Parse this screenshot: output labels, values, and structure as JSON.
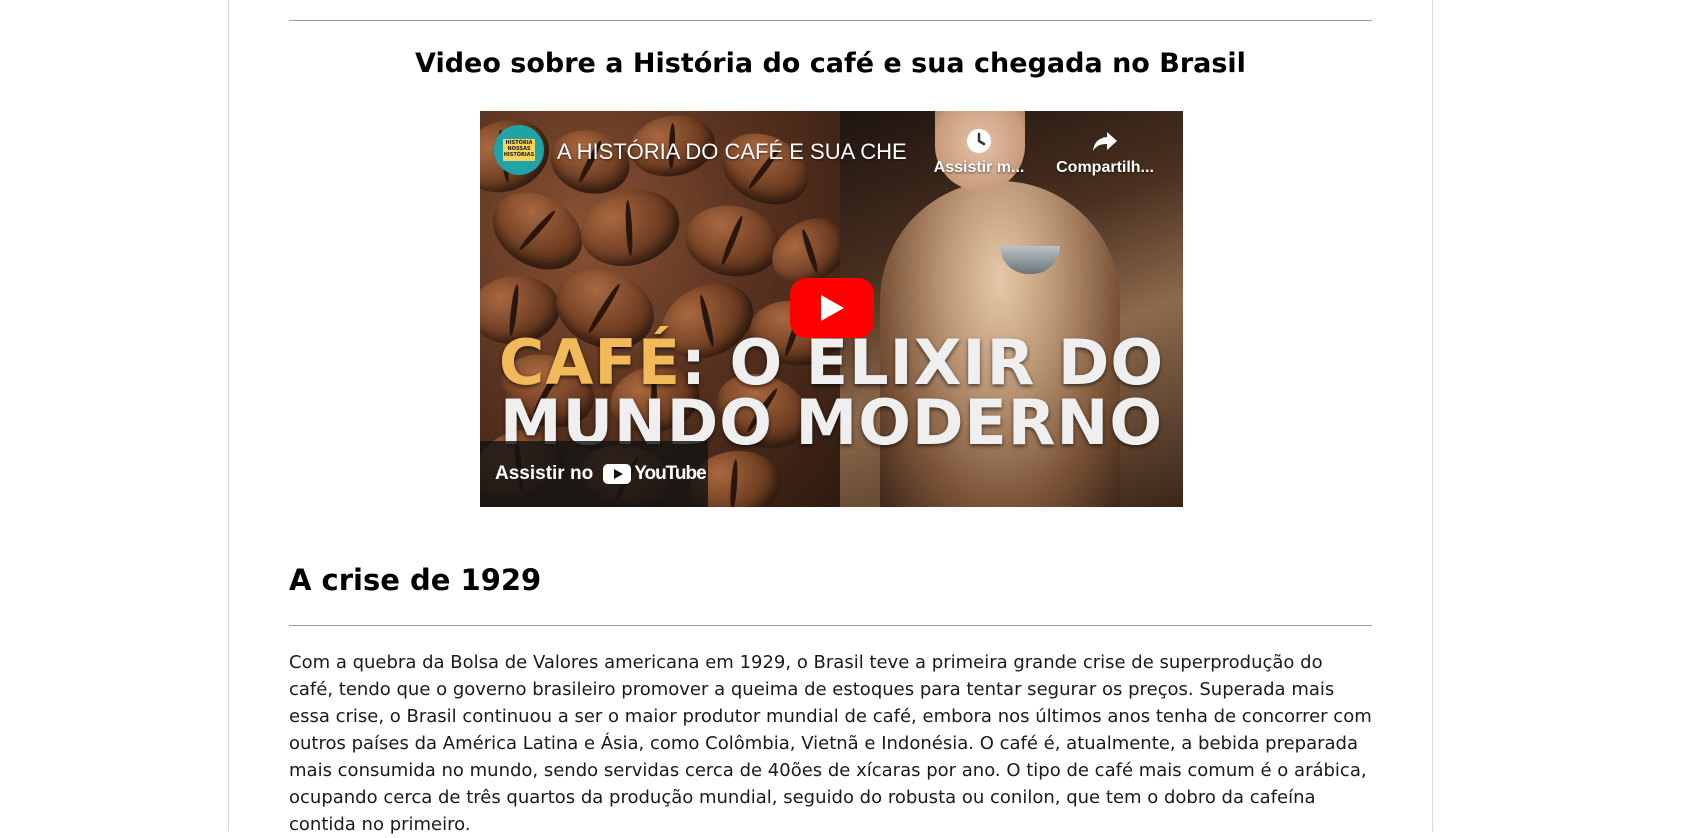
{
  "video_section": {
    "title": "Video sobre a História do café e sua chegada no Brasil"
  },
  "video_embed": {
    "channel_logo_text": "HISTÓRIA NOSSAS HISTÓRIAS",
    "video_title": "A HISTÓRIA DO CAFÉ E SUA CHE...",
    "watch_later_label": "Assistir m...",
    "share_label": "Compartilh...",
    "thumbnail_text_accent": "CAFÉ",
    "thumbnail_text_line1_rest": ": O ELIXIR DO",
    "thumbnail_text_line2": "MUNDO MODERNO",
    "watch_on_label": "Assistir no",
    "youtube_wordmark": "YouTube"
  },
  "section": {
    "heading": "A crise de 1929",
    "paragraph": "Com a quebra da Bolsa de Valores americana em 1929, o Brasil teve a primeira grande crise de superprodução do café, tendo que o governo brasileiro promover a queima de estoques para tentar segurar os preços. Superada mais essa crise, o Brasil continuou a ser o maior produtor mundial de café, embora nos últimos anos tenha de concorrer com outros países da América Latina e Ásia, como Colômbia, Vietnã e Indonésia. O café é, atualmente, a bebida preparada mais consumida no mundo, sendo servidas cerca de 40ões de xícaras por ano. O tipo de café mais comum é o arábica, ocupando cerca de três quartos da produção mundial, seguido do robusta ou conilon, que tem o dobro da cafeína contida no primeiro."
  },
  "colors": {
    "youtube_red": "#ff0000",
    "thumbnail_accent": "#f1b95a",
    "divider": "#9e9e9e"
  }
}
